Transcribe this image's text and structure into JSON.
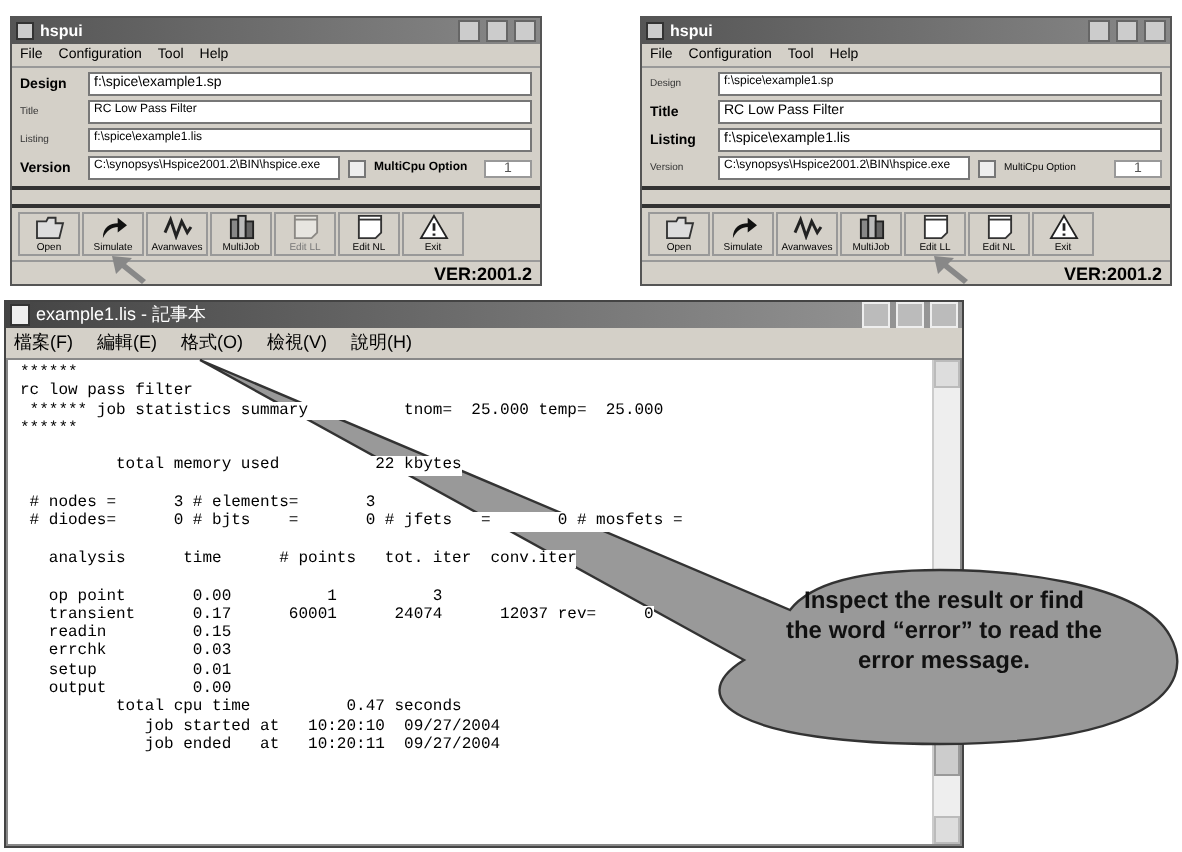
{
  "windows": [
    {
      "title": "hspui",
      "menu": [
        "File",
        "Configuration",
        "Tool",
        "Help"
      ],
      "fields": [
        {
          "label": "Design",
          "value": "f:\\spice\\example1.sp",
          "emphasized": true
        },
        {
          "label": "Title",
          "value": "RC Low Pass Filter",
          "emphasized": false
        },
        {
          "label": "Listing",
          "value": "f:\\spice\\example1.lis",
          "emphasized": false
        }
      ],
      "version": {
        "label": "Version",
        "value": "C:\\synopsys\\Hspice2001.2\\BIN\\hspice.exe",
        "emphasized": true
      },
      "multicpu": {
        "label": "MultiCpu Option",
        "value": "1",
        "emphasized": true
      },
      "toolbar": [
        {
          "label": "Open",
          "kind": "open",
          "disabled": false,
          "pointed": false
        },
        {
          "label": "Simulate",
          "kind": "simulate",
          "disabled": false,
          "pointed": true
        },
        {
          "label": "Avanwaves",
          "kind": "waves",
          "disabled": false,
          "pointed": false
        },
        {
          "label": "MultiJob",
          "kind": "multijob",
          "disabled": false,
          "pointed": false
        },
        {
          "label": "Edit LL",
          "kind": "edit",
          "disabled": true,
          "pointed": false
        },
        {
          "label": "Edit NL",
          "kind": "edit",
          "disabled": false,
          "pointed": false
        },
        {
          "label": "Exit",
          "kind": "exit",
          "disabled": false,
          "pointed": false
        }
      ],
      "version_text": "VER:2001.2"
    },
    {
      "title": "hspui",
      "menu": [
        "File",
        "Configuration",
        "Tool",
        "Help"
      ],
      "fields": [
        {
          "label": "Design",
          "value": "f:\\spice\\example1.sp",
          "emphasized": false
        },
        {
          "label": "Title",
          "value": "RC Low Pass Filter",
          "emphasized": true
        },
        {
          "label": "Listing",
          "value": "f:\\spice\\example1.lis",
          "emphasized": true
        }
      ],
      "version": {
        "label": "Version",
        "value": "C:\\synopsys\\Hspice2001.2\\BIN\\hspice.exe",
        "emphasized": false
      },
      "multicpu": {
        "label": "MultiCpu Option",
        "value": "1",
        "emphasized": false
      },
      "toolbar": [
        {
          "label": "Open",
          "kind": "open",
          "disabled": false,
          "pointed": false
        },
        {
          "label": "Simulate",
          "kind": "simulate",
          "disabled": false,
          "pointed": false
        },
        {
          "label": "Avanwaves",
          "kind": "waves",
          "disabled": false,
          "pointed": false
        },
        {
          "label": "MultiJob",
          "kind": "multijob",
          "disabled": false,
          "pointed": false
        },
        {
          "label": "Edit LL",
          "kind": "edit",
          "disabled": false,
          "pointed": true
        },
        {
          "label": "Edit NL",
          "kind": "edit",
          "disabled": false,
          "pointed": false
        },
        {
          "label": "Exit",
          "kind": "exit",
          "disabled": false,
          "pointed": false
        }
      ],
      "version_text": "VER:2001.2"
    }
  ],
  "notepad": {
    "title": "example1.lis - 記事本",
    "menu": [
      "檔案(F)",
      "編輯(E)",
      "格式(O)",
      "檢視(V)",
      "說明(H)"
    ],
    "blocks": [
      [
        "******",
        "rc low pass filter",
        " ****** job statistics summary          tnom=  25.000 temp=  25.000",
        "******"
      ],
      [
        "          total memory used          22 kbytes"
      ],
      [
        " # nodes =      3 # elements=       3",
        " # diodes=      0 # bjts    =       0 # jfets   =       0 # mosfets ="
      ],
      [
        "   analysis      time      # points   tot. iter  conv.iter"
      ],
      [
        "   op point       0.00          1          3",
        "   transient      0.17      60001      24074      12037 rev=     0",
        "   readin         0.15",
        "   errchk         0.03",
        "   setup          0.01",
        "   output         0.00",
        "          total cpu time          0.47 seconds",
        "             job started at   10:20:10  09/27/2004",
        "             job ended   at   10:20:11  09/27/2004"
      ]
    ]
  },
  "callout": {
    "text": "Inspect the result or find the word “error” to read the error message."
  }
}
